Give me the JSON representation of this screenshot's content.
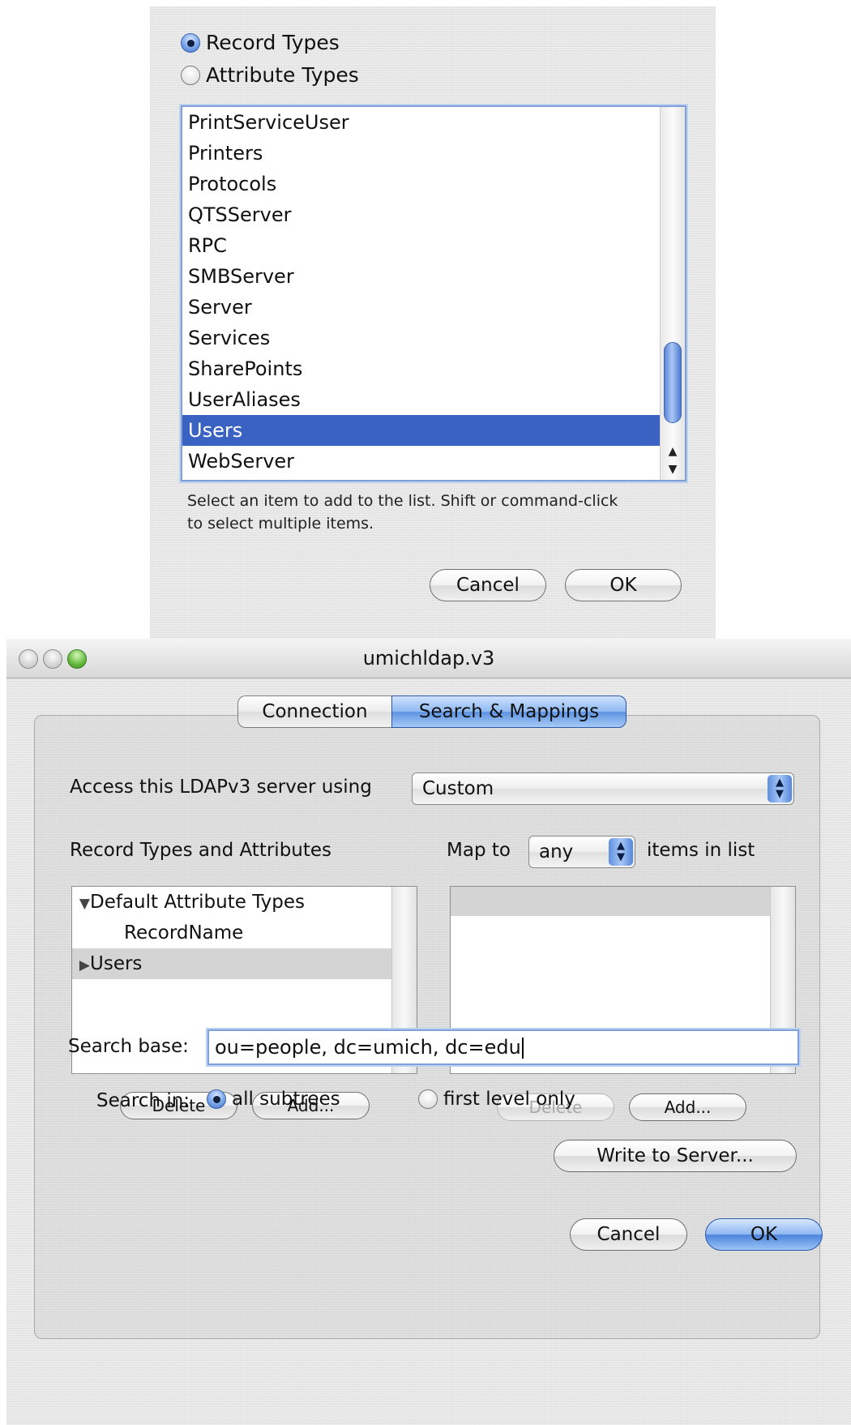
{
  "sheet": {
    "radio_record_types": "Record Types",
    "radio_attribute_types": "Attribute Types",
    "selected_radio": "Record Types",
    "list_items": [
      "PrintServiceUser",
      "Printers",
      "Protocols",
      "QTSServer",
      "RPC",
      "SMBServer",
      "Server",
      "Services",
      "SharePoints",
      "UserAliases",
      "Users",
      "WebServer"
    ],
    "selected_item": "Users",
    "caption_line1": "Select an item to add to the list. Shift or command-click",
    "caption_line2": "to select multiple items.",
    "cancel_label": "Cancel",
    "ok_label": "OK"
  },
  "window": {
    "title": "umichldap.v3",
    "tabs": [
      {
        "label": "Connection",
        "selected": false
      },
      {
        "label": "Search & Mappings",
        "selected": true
      }
    ],
    "access_label": "Access this LDAPv3 server using",
    "access_value": "Custom",
    "record_types_label": "Record Types and Attributes",
    "map_to_label": "Map to",
    "map_to_value": "any",
    "items_in_list_label": "items in list",
    "tree": [
      {
        "label": "Default Attribute Types",
        "expander": "▼",
        "level": 0,
        "selected": false
      },
      {
        "label": "RecordName",
        "expander": "",
        "level": 1,
        "selected": false
      },
      {
        "label": "Users",
        "expander": "▶",
        "level": 0,
        "selected": true
      }
    ],
    "left_delete_label": "Delete",
    "left_add_label": "Add...",
    "right_delete_label": "Delete",
    "right_add_label": "Add...",
    "search_base_label": "Search base:",
    "search_base_value": "ou=people, dc=umich, dc=edu",
    "search_in_label": "Search in:",
    "all_subtrees_label": "all subtrees",
    "first_level_label": "first level only",
    "search_in_selected": "all subtrees",
    "write_to_server_label": "Write to Server...",
    "cancel_label": "Cancel",
    "ok_label": "OK"
  }
}
